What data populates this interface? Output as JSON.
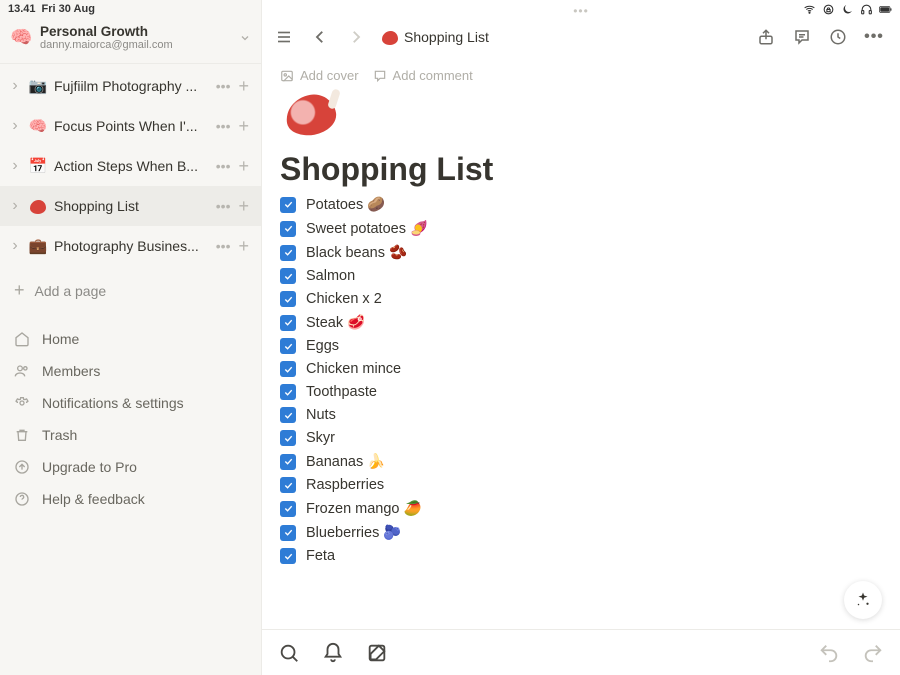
{
  "status": {
    "time": "13.41",
    "date": "Fri 30 Aug"
  },
  "workspace": {
    "emoji": "🧠",
    "title": "Personal Growth",
    "subtitle": "danny.maiorca@gmail.com"
  },
  "sidebar": {
    "pages": [
      {
        "emoji": "📷",
        "label": "Fujfiilm Photography ..."
      },
      {
        "emoji": "🧠",
        "label": "Focus Points When I'..."
      },
      {
        "emoji": "📅",
        "label": "Action Steps When B..."
      },
      {
        "emoji": "🥩",
        "label": "Shopping List",
        "active": true
      },
      {
        "emoji": "💼",
        "label": "Photography Busines..."
      }
    ],
    "add_page": "Add a page",
    "nav": {
      "home": "Home",
      "members": "Members",
      "settings": "Notifications & settings",
      "trash": "Trash",
      "upgrade": "Upgrade to Pro",
      "help": "Help & feedback"
    }
  },
  "breadcrumb": {
    "emoji": "🥩",
    "label": "Shopping List"
  },
  "cover_actions": {
    "add_cover": "Add cover",
    "add_comment": "Add comment"
  },
  "doc": {
    "emoji": "🥩",
    "title": "Shopping List",
    "items": [
      "Potatoes 🥔",
      "Sweet potatoes 🍠",
      "Black beans 🫘",
      "Salmon",
      "Chicken x 2",
      "Steak 🥩",
      "Eggs",
      "Chicken mince",
      "Toothpaste",
      "Nuts",
      "Skyr",
      "Bananas 🍌",
      "Raspberries",
      "Frozen mango 🥭",
      "Blueberries 🫐",
      "Feta"
    ]
  }
}
